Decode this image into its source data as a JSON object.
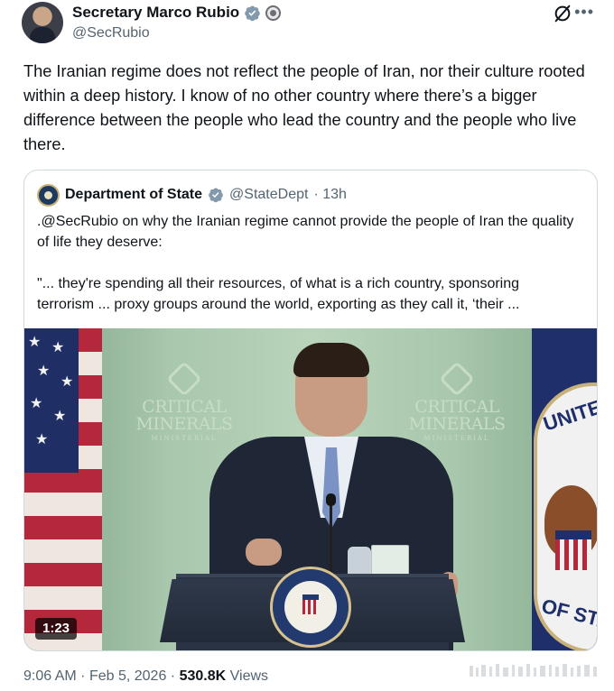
{
  "author": {
    "name": "Secretary Marco Rubio",
    "handle": "@SecRubio"
  },
  "tweet": {
    "text": "The Iranian regime does not reflect the people of Iran, nor their culture rooted within a deep history. I know of no other country where there’s a bigger difference between the people who lead the country and the people who live there."
  },
  "quoted": {
    "name": "Department of State",
    "handle": "@StateDept",
    "time": "· 13h",
    "line1": ".@SecRubio on why the Iranian regime cannot provide the people of Iran the quality of life they deserve:",
    "line2": "\"... they're spending all their resources, of what is a rich country, sponsoring terrorism ... proxy groups around the world, exporting as they call it, ‘their ...",
    "media": {
      "duration": "1:23",
      "backdrop_text_left": "CRITICAL MINERALS",
      "backdrop_sub_left": "MINISTERIAL",
      "backdrop_text_right": "CRITICAL MINERALS",
      "backdrop_sub_right": "MINISTERIAL",
      "seal_top": "UNITE",
      "seal_bottom": "OF STA"
    }
  },
  "meta": {
    "time": "9:06 AM",
    "date": "Feb 5, 2026",
    "sep": "·",
    "views_count": "530.8K",
    "views_label": "Views"
  },
  "colors": {
    "verified": "#1d9bf0",
    "text": "#0f1419",
    "secondary": "#536471",
    "border": "#cfd9de"
  }
}
